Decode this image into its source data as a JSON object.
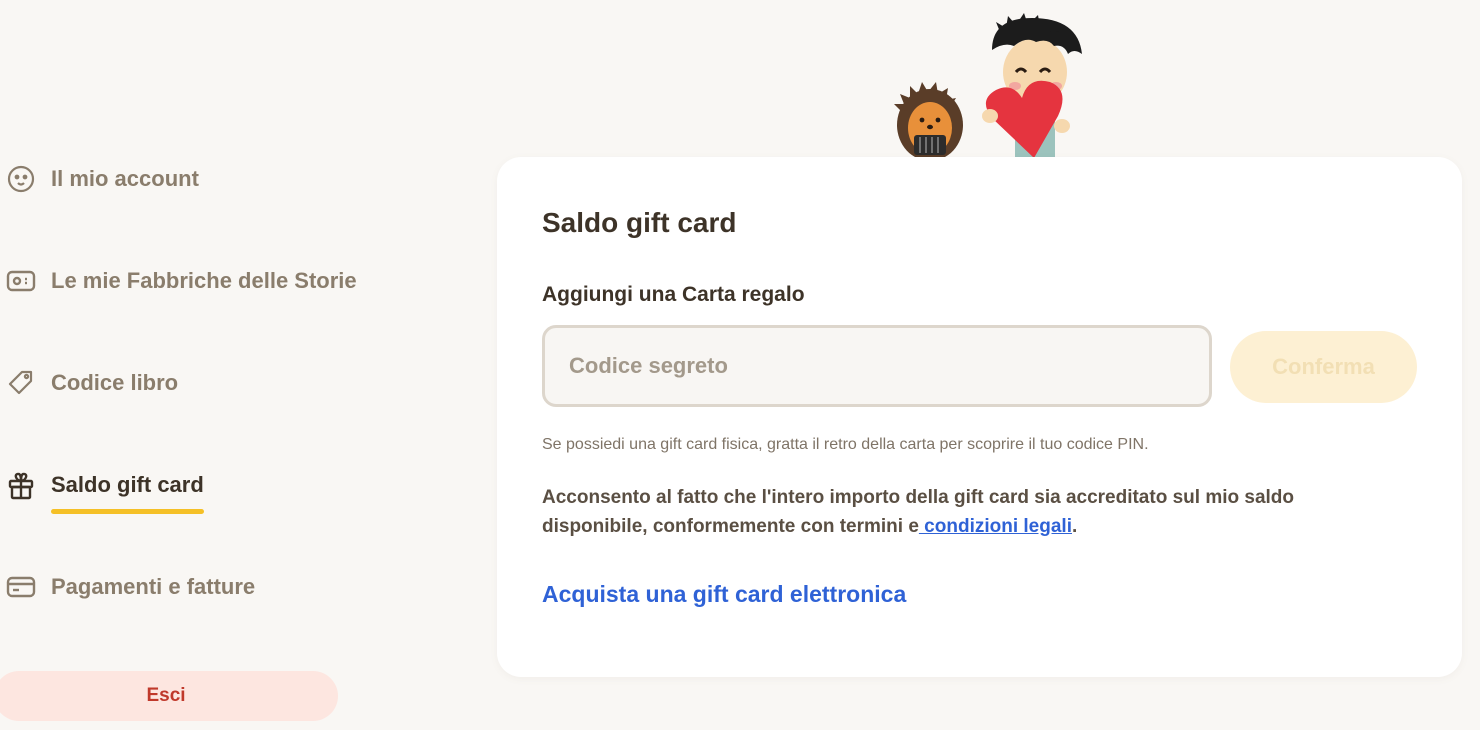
{
  "sidebar": {
    "items": [
      {
        "label": "Il mio account",
        "icon": "face-icon"
      },
      {
        "label": "Le mie Fabbriche delle Storie",
        "icon": "id-card-icon"
      },
      {
        "label": "Codice libro",
        "icon": "tag-icon"
      },
      {
        "label": "Saldo gift card",
        "icon": "gift-icon",
        "active": true
      },
      {
        "label": "Pagamenti e fatture",
        "icon": "credit-card-icon"
      }
    ],
    "logout_label": "Esci"
  },
  "card": {
    "title": "Saldo gift card",
    "field_label": "Aggiungi una Carta regalo",
    "input": {
      "placeholder": "Codice segreto",
      "value": ""
    },
    "confirm_label": "Conferma",
    "hint": "Se possiedi una gift card fisica, gratta il retro della carta per scoprire il tuo codice PIN.",
    "consent_text": "Acconsento al fatto che l'intero importo della gift card sia accreditato sul mio saldo disponibile, conformemente con termini e",
    "consent_link": " condizioni legali",
    "consent_end": ".",
    "buy_link": "Acquista una gift card elettronica"
  },
  "colors": {
    "accent_underline": "#f5c026",
    "link": "#2f62d6",
    "logout_bg": "#fde6e0",
    "logout_text": "#c0392b",
    "confirm_disabled_bg": "#fdf0d3"
  }
}
